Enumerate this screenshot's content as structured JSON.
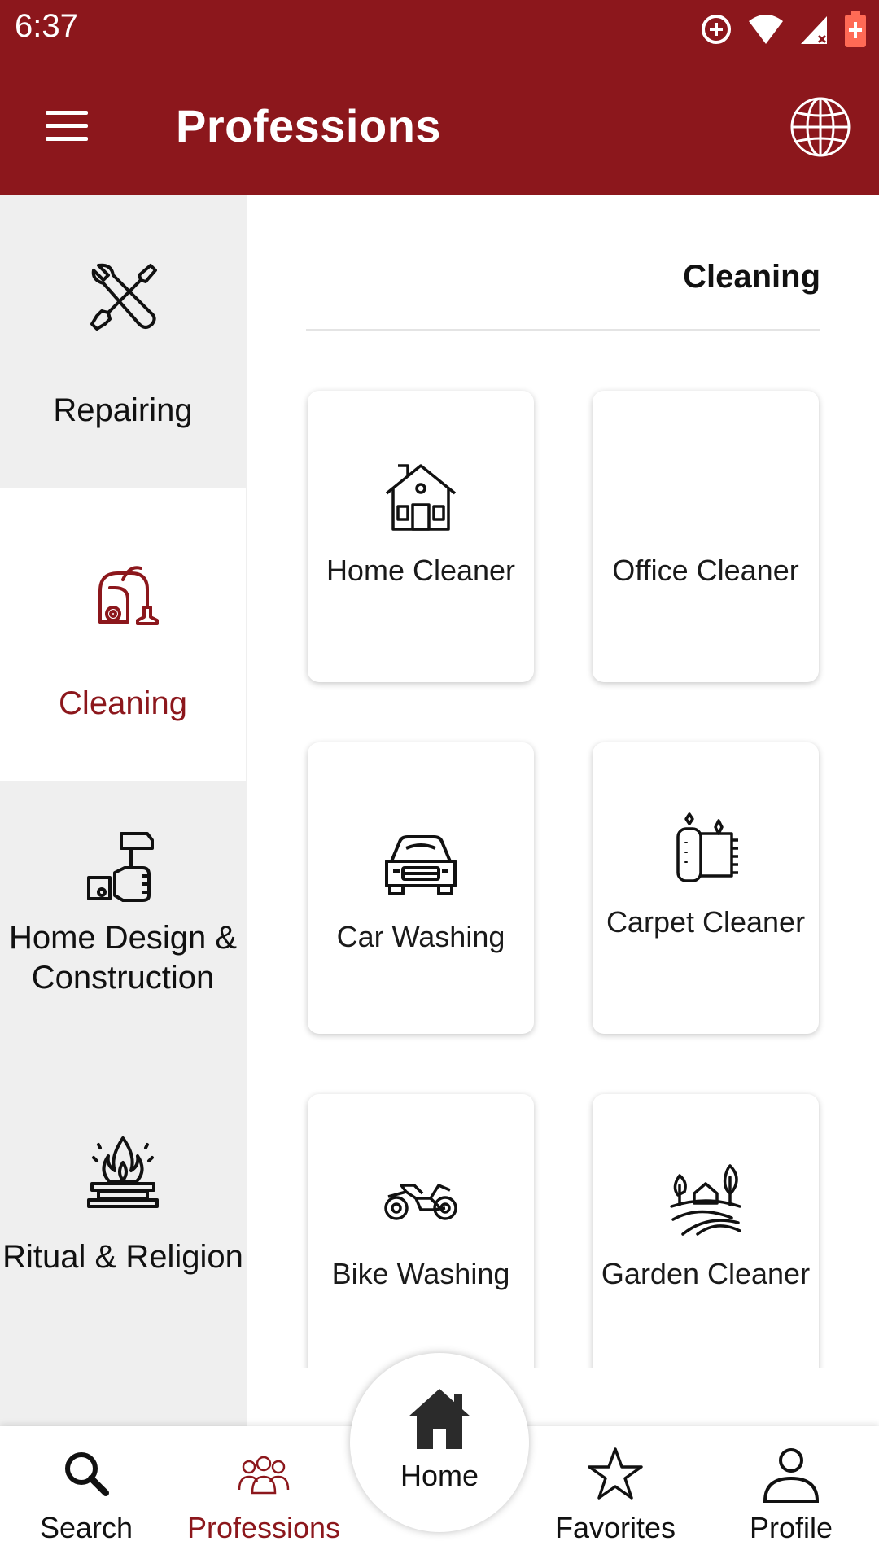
{
  "status_bar": {
    "time": "6:37",
    "icons": [
      "sync-icon",
      "wifi-icon",
      "signal-icon",
      "battery-icon"
    ]
  },
  "app_bar": {
    "title": "Professions",
    "menu_icon": "menu-icon",
    "globe_icon": "globe-icon"
  },
  "sidebar": {
    "items": [
      {
        "label": "Repairing",
        "icon": "tools-icon"
      },
      {
        "label": "Cleaning",
        "icon": "vacuum-icon",
        "active": true
      },
      {
        "label": "Home Design & Construction",
        "icon": "construction-icon"
      },
      {
        "label": "Ritual & Religion",
        "icon": "fire-ritual-icon"
      }
    ]
  },
  "content": {
    "section_title": "Cleaning",
    "cards": [
      {
        "label": "Home Cleaner",
        "icon": "house-icon"
      },
      {
        "label": "Office Cleaner",
        "icon": ""
      },
      {
        "label": "Car Washing",
        "icon": "car-icon"
      },
      {
        "label": "Carpet Cleaner",
        "icon": "carpet-icon"
      },
      {
        "label": "Bike Washing",
        "icon": "motorbike-icon"
      },
      {
        "label": "Garden Cleaner",
        "icon": "garden-icon"
      }
    ]
  },
  "bottom_nav": {
    "search": "Search",
    "professions": "Professions",
    "home": "Home",
    "favorites": "Favorites",
    "profile": "Profile"
  },
  "colors": {
    "primary": "#8c171c",
    "sidebar_bg": "#efefef",
    "text": "#111111"
  }
}
